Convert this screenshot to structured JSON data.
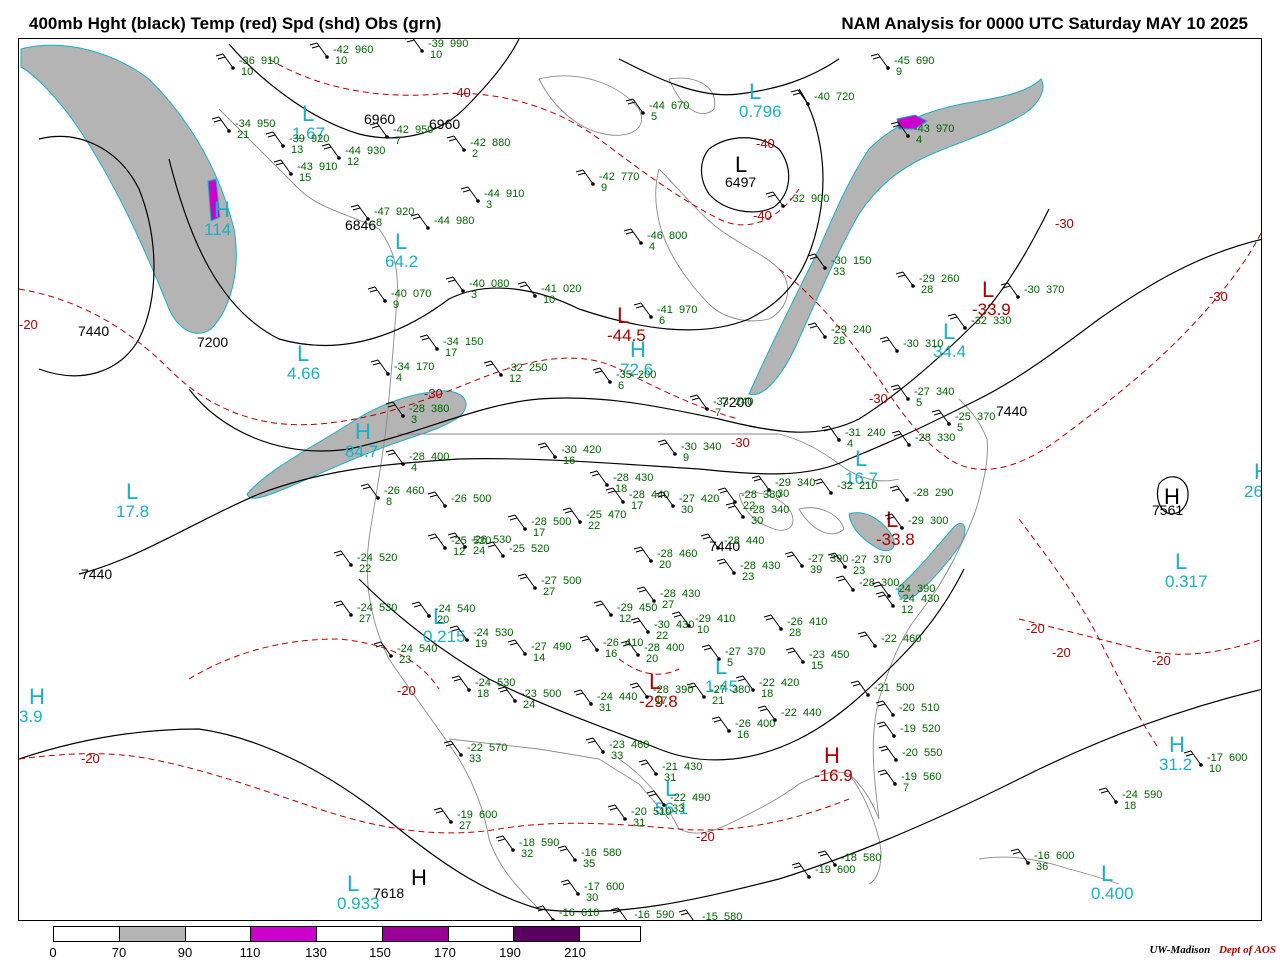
{
  "header": {
    "left_title": "400mb Hght (black) Temp (red) Spd (shd) Obs (grn)",
    "right_title": "NAM Analysis for 0000 UTC Saturday  MAY 10 2025"
  },
  "colors": {
    "height": "#000000",
    "temperature": "#b00000",
    "observations": "#006400",
    "centers": "#1ab0c8",
    "speed_70_90": "#b4b4b4",
    "speed_110_130": "#cc00cc",
    "speed_150_170": "#990099",
    "speed_190_210": "#5a0060"
  },
  "colorbar": {
    "ticks": [
      "0",
      "70",
      "90",
      "110",
      "130",
      "150",
      "170",
      "190",
      "210"
    ],
    "segment_colors": [
      "#ffffff",
      "#b4b4b4",
      "#ffffff",
      "#cc00cc",
      "#ffffff",
      "#990099",
      "#ffffff",
      "#5a0060",
      "#ffffff"
    ]
  },
  "credit": {
    "org": "UW-Madison",
    "dept": "Dept of AOS"
  },
  "height_labels": [
    "6960",
    "6960",
    "6846",
    "7440",
    "7200",
    "7200",
    "6497",
    "7440",
    "7440",
    "7440",
    "7561",
    "7618"
  ],
  "temp_labels": [
    "-40",
    "-40",
    "-40",
    "-30",
    "-30",
    "-30",
    "-30",
    "-20",
    "-20",
    "-20",
    "-20",
    "-20",
    "-20",
    "-20",
    "-30"
  ],
  "centers": [
    {
      "letter": "L",
      "value": "1.67",
      "color": "#1ab0c8"
    },
    {
      "letter": "L",
      "value": "0.796",
      "color": "#1ab0c8"
    },
    {
      "letter": "H",
      "value": "114",
      "color": "#1ab0c8"
    },
    {
      "letter": "L",
      "value": "64.2",
      "color": "#1ab0c8"
    },
    {
      "letter": "L",
      "value": "4.66",
      "color": "#1ab0c8"
    },
    {
      "letter": "H",
      "value": "84.7",
      "color": "#1ab0c8"
    },
    {
      "letter": "L",
      "value": "17.8",
      "color": "#1ab0c8"
    },
    {
      "letter": "H",
      "value": "72.6",
      "color": "#1ab0c8"
    },
    {
      "letter": "L",
      "value": "-44.5",
      "color": "#b00000"
    },
    {
      "letter": "L",
      "value": "16.7",
      "color": "#1ab0c8"
    },
    {
      "letter": "L",
      "value": "-33.8",
      "color": "#b00000"
    },
    {
      "letter": "L",
      "value": "0.215",
      "color": "#1ab0c8"
    },
    {
      "letter": "L",
      "value": "1.45",
      "color": "#1ab0c8"
    },
    {
      "letter": "L",
      "value": "-29.8",
      "color": "#b00000"
    },
    {
      "letter": "L",
      "value": "56.1",
      "color": "#1ab0c8"
    },
    {
      "letter": "H",
      "value": "-16.9",
      "color": "#b00000"
    },
    {
      "letter": "L",
      "value": "0.933",
      "color": "#1ab0c8"
    },
    {
      "letter": "H",
      "value": "3.9",
      "color": "#1ab0c8"
    },
    {
      "letter": "L",
      "value": "0.317",
      "color": "#1ab0c8"
    },
    {
      "letter": "H",
      "value": "26.",
      "color": "#1ab0c8"
    },
    {
      "letter": "H",
      "value": "31.2",
      "color": "#1ab0c8"
    },
    {
      "letter": "L",
      "value": "0.400",
      "color": "#1ab0c8"
    },
    {
      "letter": "L",
      "value": "-33.9",
      "color": "#b00000"
    },
    {
      "letter": "L",
      "value": "34.4",
      "color": "#1ab0c8"
    },
    {
      "letter": "H",
      "value": "",
      "color": "#000000"
    },
    {
      "letter": "H",
      "value": "",
      "color": "#000000"
    },
    {
      "letter": "L",
      "value": "",
      "color": "#000000"
    }
  ],
  "observations": [
    {
      "t": "-36",
      "h": "910",
      "d": "10"
    },
    {
      "t": "-42",
      "h": "960",
      "d": "10"
    },
    {
      "t": "-39",
      "h": "990",
      "d": "10"
    },
    {
      "t": "-34",
      "h": "950",
      "d": "21"
    },
    {
      "t": "-42",
      "h": "950",
      "d": "7"
    },
    {
      "t": "-39",
      "h": "920",
      "d": "13"
    },
    {
      "t": "-44",
      "h": "930",
      "d": "12"
    },
    {
      "t": "-43",
      "h": "910",
      "d": "15"
    },
    {
      "t": "-42",
      "h": "880",
      "d": "2"
    },
    {
      "t": "-44",
      "h": "670",
      "d": "5"
    },
    {
      "t": "-42",
      "h": "770",
      "d": "9"
    },
    {
      "t": "-44",
      "h": "910",
      "d": "3"
    },
    {
      "t": "-47",
      "h": "920",
      "d": "8"
    },
    {
      "t": "-44",
      "h": "980",
      "d": ""
    },
    {
      "t": "-46",
      "h": "800",
      "d": "4"
    },
    {
      "t": "-40",
      "h": "720",
      "d": ""
    },
    {
      "t": "-45",
      "h": "690",
      "d": "9"
    },
    {
      "t": "-43",
      "h": "970",
      "d": "4"
    },
    {
      "t": "-32",
      "h": "900",
      "d": ""
    },
    {
      "t": "-40",
      "h": "070",
      "d": "9"
    },
    {
      "t": "-40",
      "h": "080",
      "d": "3"
    },
    {
      "t": "-41",
      "h": "020",
      "d": "10"
    },
    {
      "t": "-41",
      "h": "970",
      "d": "6"
    },
    {
      "t": "-30",
      "h": "150",
      "d": "33"
    },
    {
      "t": "-29",
      "h": "260",
      "d": "28"
    },
    {
      "t": "-30",
      "h": "370",
      "d": ""
    },
    {
      "t": "-32",
      "h": "330",
      "d": ""
    },
    {
      "t": "-29",
      "h": "240",
      "d": "28"
    },
    {
      "t": "-30",
      "h": "310",
      "d": ""
    },
    {
      "t": "-34",
      "h": "150",
      "d": "17"
    },
    {
      "t": "-34",
      "h": "170",
      "d": "4"
    },
    {
      "t": "-32",
      "h": "250",
      "d": "12"
    },
    {
      "t": "-35",
      "h": "200",
      "d": "6"
    },
    {
      "t": "-27",
      "h": "340",
      "d": "5"
    },
    {
      "t": "-25",
      "h": "370",
      "d": "5"
    },
    {
      "t": "-28",
      "h": "330",
      "d": ""
    },
    {
      "t": "-28",
      "h": "380",
      "d": "3"
    },
    {
      "t": "-28",
      "h": "400",
      "d": "4"
    },
    {
      "t": "-30",
      "h": "420",
      "d": "16"
    },
    {
      "t": "-30",
      "h": "340",
      "d": "9"
    },
    {
      "t": "-33",
      "h": "240",
      "d": "7"
    },
    {
      "t": "-31",
      "h": "240",
      "d": "4"
    },
    {
      "t": "-28",
      "h": "290",
      "d": ""
    },
    {
      "t": "-32",
      "h": "210",
      "d": ""
    },
    {
      "t": "-26",
      "h": "460",
      "d": "8"
    },
    {
      "t": "-26",
      "h": "500",
      "d": ""
    },
    {
      "t": "-28",
      "h": "430",
      "d": "18"
    },
    {
      "t": "-28",
      "h": "440",
      "d": "17"
    },
    {
      "t": "-27",
      "h": "420",
      "d": "30"
    },
    {
      "t": "-28",
      "h": "380",
      "d": "22"
    },
    {
      "t": "-29",
      "h": "340",
      "d": "30"
    },
    {
      "t": "-28",
      "h": "340",
      "d": "30"
    },
    {
      "t": "-25",
      "h": "470",
      "d": "22"
    },
    {
      "t": "-28",
      "h": "500",
      "d": "17"
    },
    {
      "t": "-25",
      "h": "520",
      "d": "12"
    },
    {
      "t": "-26",
      "h": "530",
      "d": "24"
    },
    {
      "t": "-25",
      "h": "520",
      "d": ""
    },
    {
      "t": "-24",
      "h": "520",
      "d": "22"
    },
    {
      "t": "-27",
      "h": "500",
      "d": "27"
    },
    {
      "t": "-28",
      "h": "460",
      "d": "20"
    },
    {
      "t": "-28",
      "h": "440",
      "d": ""
    },
    {
      "t": "-28",
      "h": "430",
      "d": "23"
    },
    {
      "t": "-27",
      "h": "390",
      "d": "39"
    },
    {
      "t": "-28",
      "h": "300",
      "d": ""
    },
    {
      "t": "-27",
      "h": "370",
      "d": "23"
    },
    {
      "t": "-24",
      "h": "390",
      "d": ""
    },
    {
      "t": "-24",
      "h": "430",
      "d": "12"
    },
    {
      "t": "-24",
      "h": "530",
      "d": "27"
    },
    {
      "t": "-24",
      "h": "540",
      "d": "20"
    },
    {
      "t": "-24",
      "h": "530",
      "d": "19"
    },
    {
      "t": "-24",
      "h": "540",
      "d": "23"
    },
    {
      "t": "-29",
      "h": "450",
      "d": "12"
    },
    {
      "t": "-28",
      "h": "430",
      "d": "27"
    },
    {
      "t": "-30",
      "h": "430",
      "d": "22"
    },
    {
      "t": "-29",
      "h": "410",
      "d": "10"
    },
    {
      "t": "-26",
      "h": "410",
      "d": "28"
    },
    {
      "t": "-22",
      "h": "460",
      "d": ""
    },
    {
      "t": "-27",
      "h": "490",
      "d": "14"
    },
    {
      "t": "-26",
      "h": "410",
      "d": "16"
    },
    {
      "t": "-28",
      "h": "400",
      "d": "20"
    },
    {
      "t": "-27",
      "h": "370",
      "d": "5"
    },
    {
      "t": "-23",
      "h": "450",
      "d": "15"
    },
    {
      "t": "-24",
      "h": "530",
      "d": "18"
    },
    {
      "t": "-23",
      "h": "500",
      "d": "24"
    },
    {
      "t": "-24",
      "h": "440",
      "d": "31"
    },
    {
      "t": "-28",
      "h": "390",
      "d": "17"
    },
    {
      "t": "-27",
      "h": "380",
      "d": "21"
    },
    {
      "t": "-22",
      "h": "420",
      "d": "18"
    },
    {
      "t": "-21",
      "h": "500",
      "d": ""
    },
    {
      "t": "-26",
      "h": "400",
      "d": "16"
    },
    {
      "t": "-22",
      "h": "440",
      "d": ""
    },
    {
      "t": "-20",
      "h": "510",
      "d": ""
    },
    {
      "t": "-19",
      "h": "520",
      "d": ""
    },
    {
      "t": "-20",
      "h": "550",
      "d": ""
    },
    {
      "t": "-19",
      "h": "560",
      "d": "7"
    },
    {
      "t": "-23",
      "h": "460",
      "d": "33"
    },
    {
      "t": "-21",
      "h": "430",
      "d": "31"
    },
    {
      "t": "-22",
      "h": "490",
      "d": "33"
    },
    {
      "t": "-20",
      "h": "510",
      "d": "31"
    },
    {
      "t": "-22",
      "h": "570",
      "d": "33"
    },
    {
      "t": "-19",
      "h": "600",
      "d": "27"
    },
    {
      "t": "-18",
      "h": "590",
      "d": "32"
    },
    {
      "t": "-16",
      "h": "580",
      "d": "35"
    },
    {
      "t": "-17",
      "h": "600",
      "d": "30"
    },
    {
      "t": "-16",
      "h": "610",
      "d": ""
    },
    {
      "t": "-16",
      "h": "590",
      "d": ""
    },
    {
      "t": "-15",
      "h": "580",
      "d": ""
    },
    {
      "t": "-19",
      "h": "600",
      "d": ""
    },
    {
      "t": "-18",
      "h": "580",
      "d": ""
    },
    {
      "t": "-17",
      "h": "600",
      "d": "10"
    },
    {
      "t": "-24",
      "h": "590",
      "d": "18"
    },
    {
      "t": "-16",
      "h": "600",
      "d": "36"
    },
    {
      "t": "-29",
      "h": "300",
      "d": ""
    }
  ]
}
